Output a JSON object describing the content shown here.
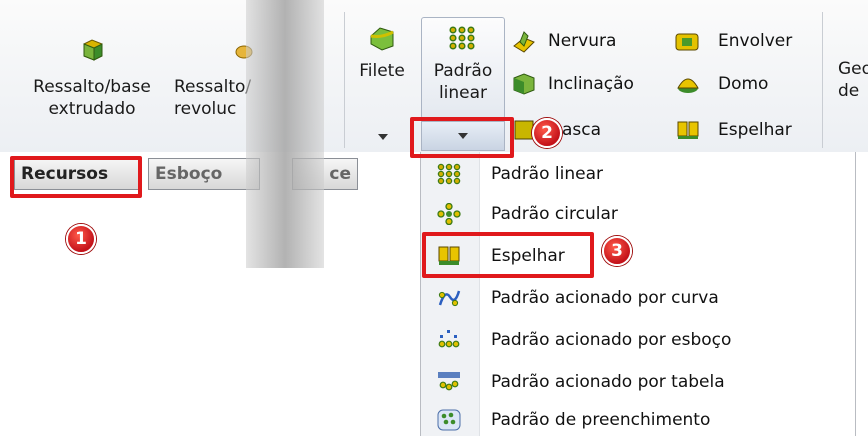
{
  "ribbon": {
    "ressalto_base": {
      "line1": "Ressalto/base",
      "line2": "extrudado"
    },
    "ressalto_revolucionado": {
      "line1": "Ressalto/",
      "line2": "revoluc"
    },
    "filete": {
      "label": "Filete"
    },
    "padrao_linear": {
      "line1": "Padrão",
      "line2": "linear"
    },
    "small_col1": [
      "Nervura",
      "Inclinação",
      "asca"
    ],
    "small_col2": [
      "Envolver",
      "Domo",
      "Espelhar"
    ],
    "geo": {
      "line1": "Geo",
      "line2": "de"
    }
  },
  "tabs": {
    "recursos": "Recursos",
    "esboco": "Esboço",
    "extra": "ce"
  },
  "menu": {
    "items": [
      {
        "label": "Padrão linear",
        "icon": "linear-pattern-icon"
      },
      {
        "label": "Padrão circular",
        "icon": "circular-pattern-icon"
      },
      {
        "label": "Espelhar",
        "icon": "mirror-icon"
      },
      {
        "label": "Padrão acionado por curva",
        "icon": "curve-pattern-icon"
      },
      {
        "label": "Padrão acionado por esboço",
        "icon": "sketch-pattern-icon"
      },
      {
        "label": "Padrão acionado por tabela",
        "icon": "table-pattern-icon"
      },
      {
        "label": "Padrão de preenchimento",
        "icon": "fill-pattern-icon"
      }
    ]
  },
  "annotations": {
    "step1": "1",
    "step2": "2",
    "step3": "3"
  },
  "colors": {
    "highlight": "#e0191c",
    "ribbon_bg": "#eceff3",
    "menu_bg": "#ffffff"
  }
}
